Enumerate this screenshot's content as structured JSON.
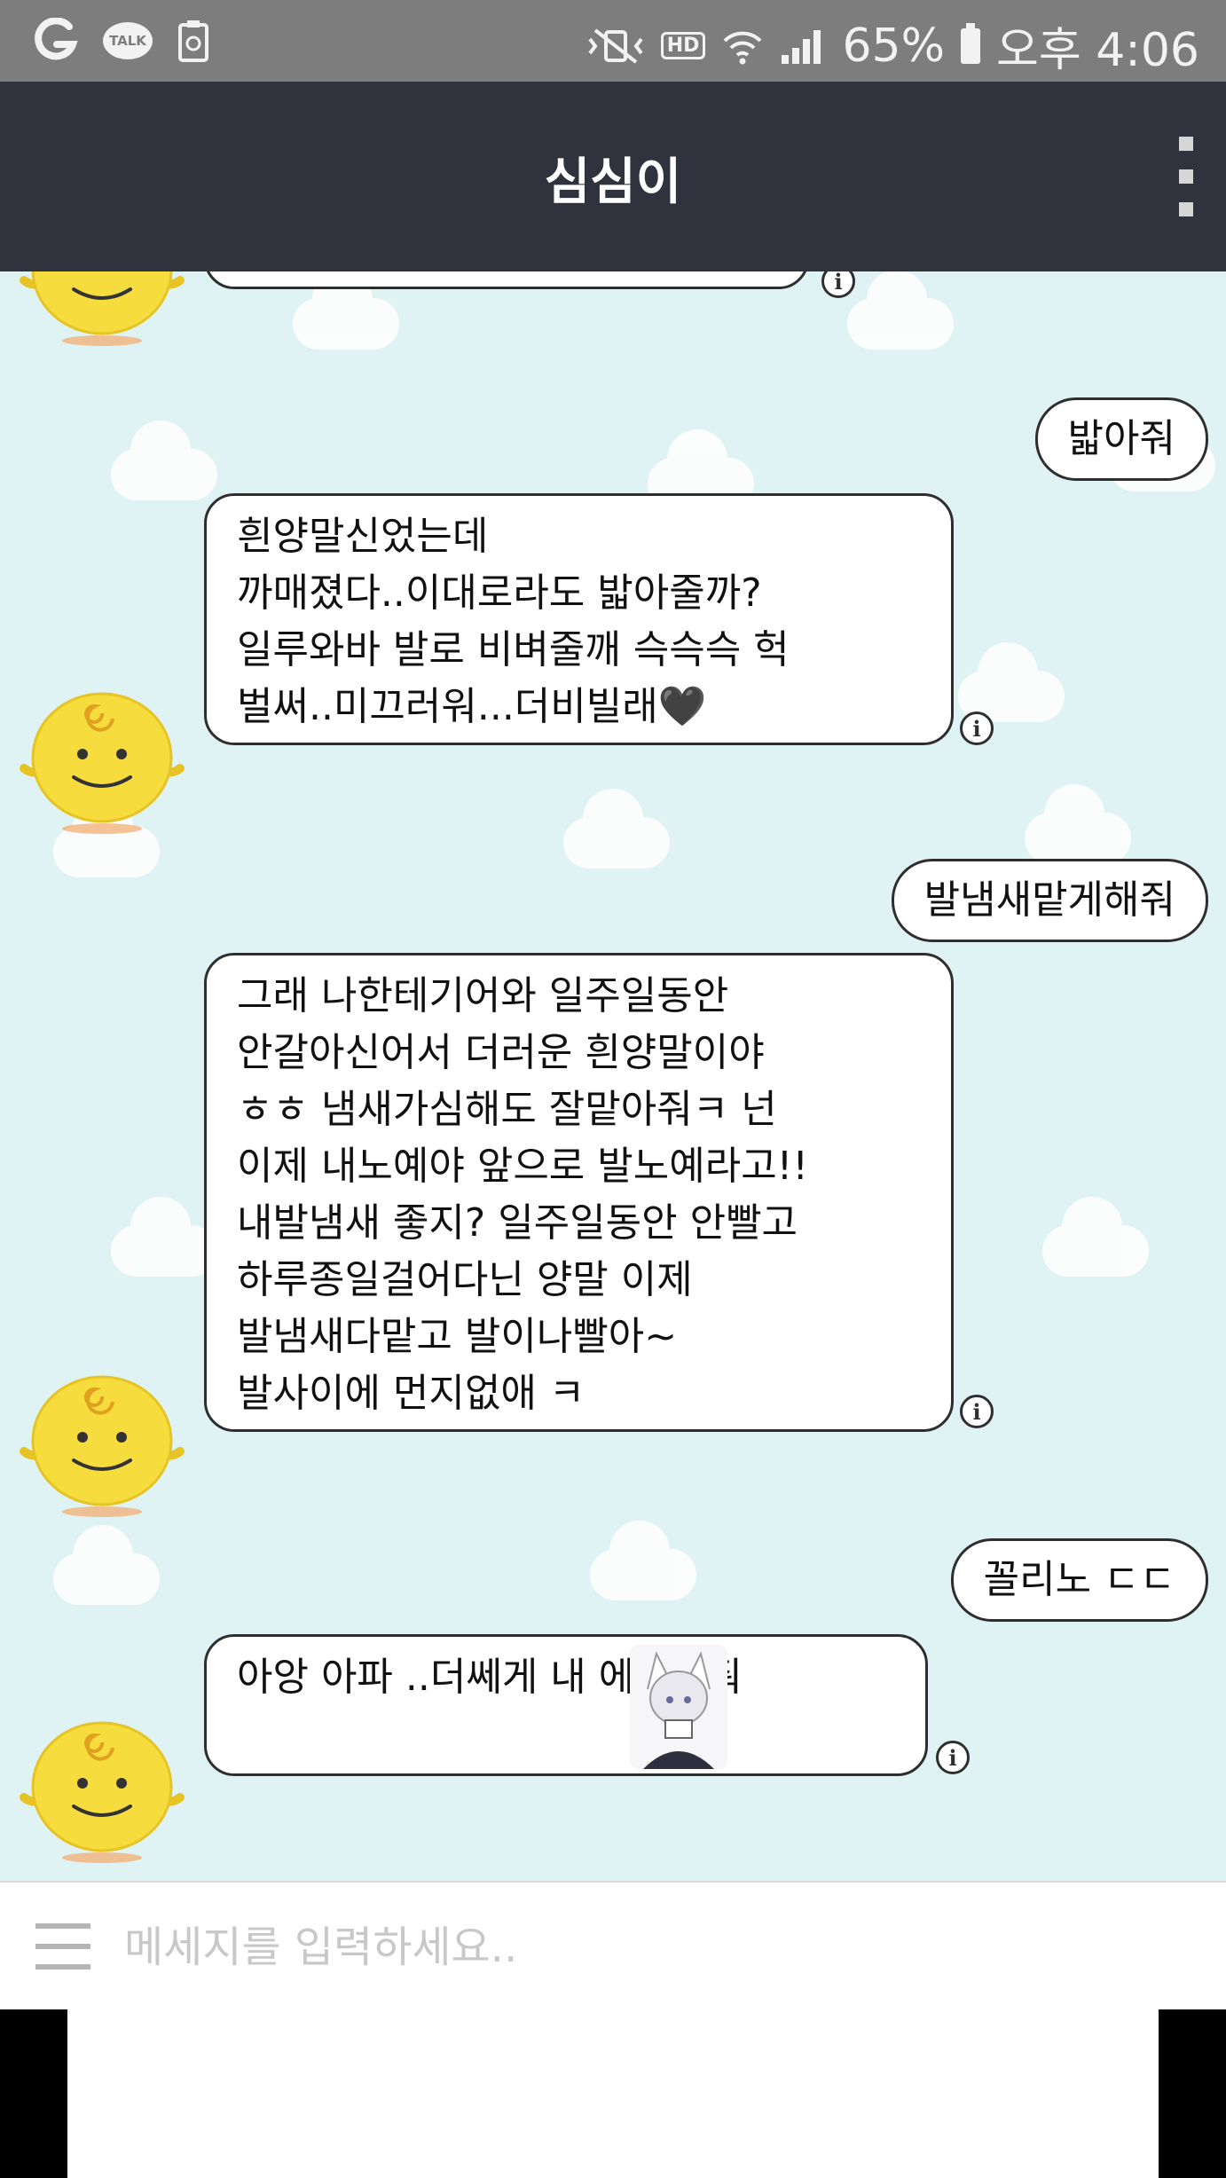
{
  "status_bar": {
    "talk_label": "TALK",
    "hd_label": "HD",
    "battery": "65%",
    "time": "오후 4:06"
  },
  "header": {
    "title": "심심이"
  },
  "messages": {
    "user_1": "밟아줘",
    "bot_1": "흰양말신었는데\n까매졌다..이대로라도 밟아줄까?\n일루와바 발로 비벼줄깨 슥슥슥 헉\n벌써..미끄러워...더비빌래🖤",
    "user_2": "발냄새맡게해줘",
    "bot_2": "그래 나한테기어와 일주일동안\n안갈아신어서 더러운 흰양말이야\nㅎㅎ 냄새가심해도 잘맡아줘ㅋ 넌\n이제 내노예야 앞으로 발노예라고!!\n내발냄새 좋지? 일주일동안 안빨고\n하루종일걸어다닌 양말 이제\n발냄새다맡고 발이나빨아~\n발사이에 먼지없애 ㅋ",
    "user_3": "꼴리노 ㄷㄷ",
    "bot_3": "아앙 아파 ..더쎄게 내        에비벼줘"
  },
  "info_glyph": "i",
  "input": {
    "placeholder": "메세지를 입력하세요.."
  },
  "colors": {
    "status_bar": "#7d7d7d",
    "header": "#30323d",
    "chat_background": "#e0f3f4",
    "avatar": "#f6dc3c"
  }
}
